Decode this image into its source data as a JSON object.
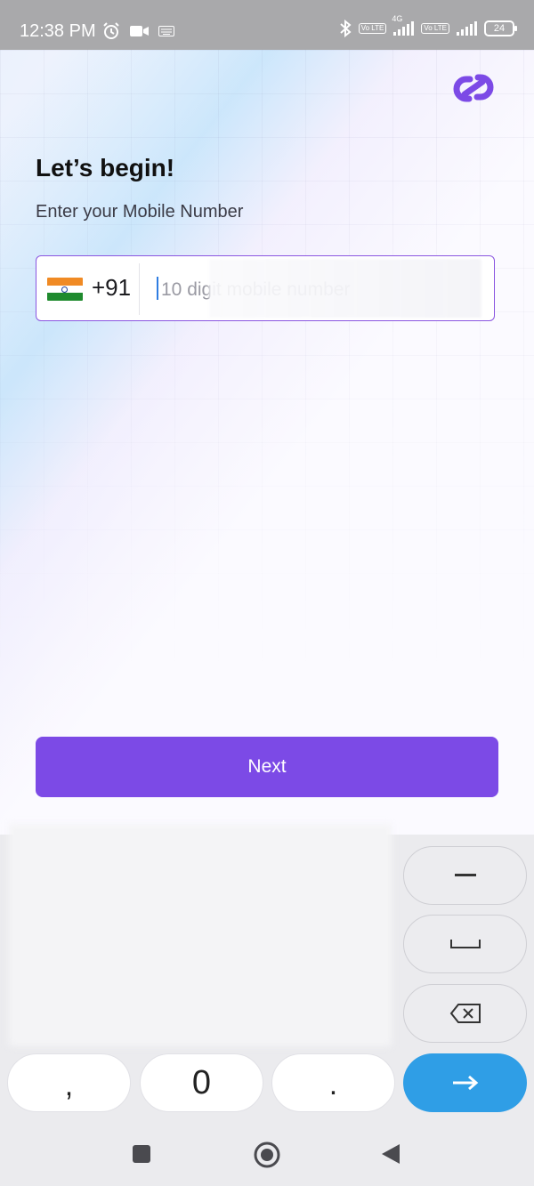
{
  "status_bar": {
    "time": "12:38 PM",
    "network_1": "4G",
    "volte_label": "Vo LTE",
    "battery": "24"
  },
  "screen": {
    "title": "Let’s begin!",
    "subtitle": "Enter your Mobile Number"
  },
  "phone": {
    "country_code": "+91",
    "placeholder": "10 digit mobile number",
    "value": ""
  },
  "actions": {
    "next_label": "Next"
  },
  "keyboard": {
    "comma": ",",
    "zero": "0",
    "dot": "."
  },
  "colors": {
    "accent": "#7c4ae6",
    "input_border": "#8a55e0",
    "enter_key": "#2f9ee6"
  }
}
